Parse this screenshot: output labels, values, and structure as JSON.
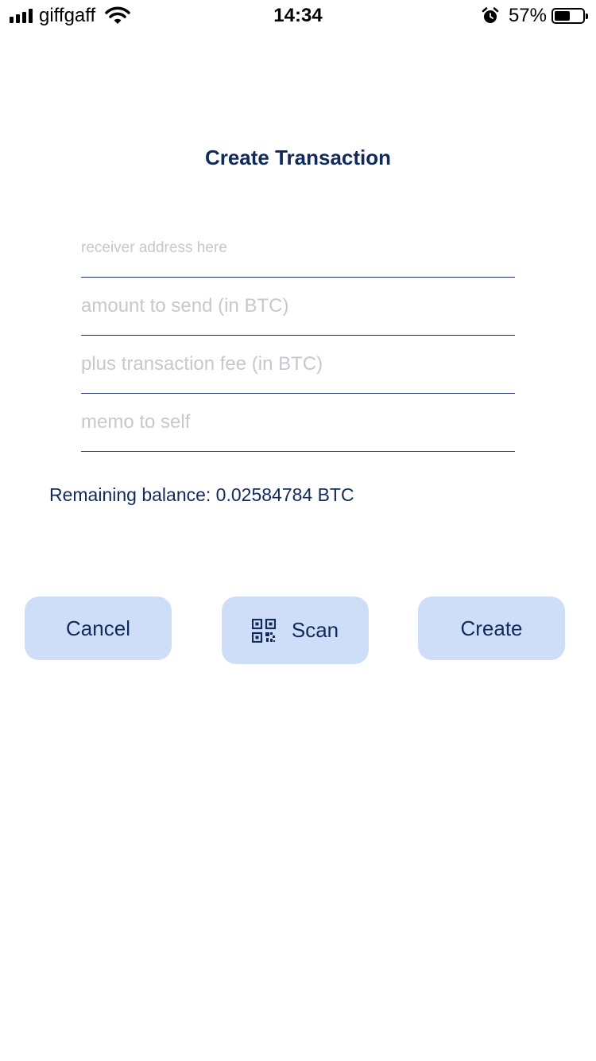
{
  "status_bar": {
    "carrier": "giffgaff",
    "time": "14:34",
    "battery_percent": "57%",
    "battery_level": 0.57,
    "icons": [
      "signal-icon",
      "wifi-icon",
      "alarm-icon",
      "battery-icon"
    ]
  },
  "page": {
    "title": "Create Transaction"
  },
  "form": {
    "receiver": {
      "value": "",
      "placeholder": "receiver address here"
    },
    "amount": {
      "value": "",
      "placeholder": "amount to send (in BTC)"
    },
    "fee": {
      "value": "",
      "placeholder": "plus transaction fee (in BTC)"
    },
    "memo": {
      "value": "",
      "placeholder": "memo to self"
    }
  },
  "balance": {
    "text": "Remaining balance: 0.02584784 BTC"
  },
  "actions": {
    "cancel_label": "Cancel",
    "scan_label": "Scan",
    "scan_icon": "qr-code-icon",
    "create_label": "Create"
  },
  "colors": {
    "accent": "#102a5c",
    "button_bg": "#cfdef8",
    "placeholder": "#c7c7cd",
    "underline": "#1d2f6b"
  }
}
